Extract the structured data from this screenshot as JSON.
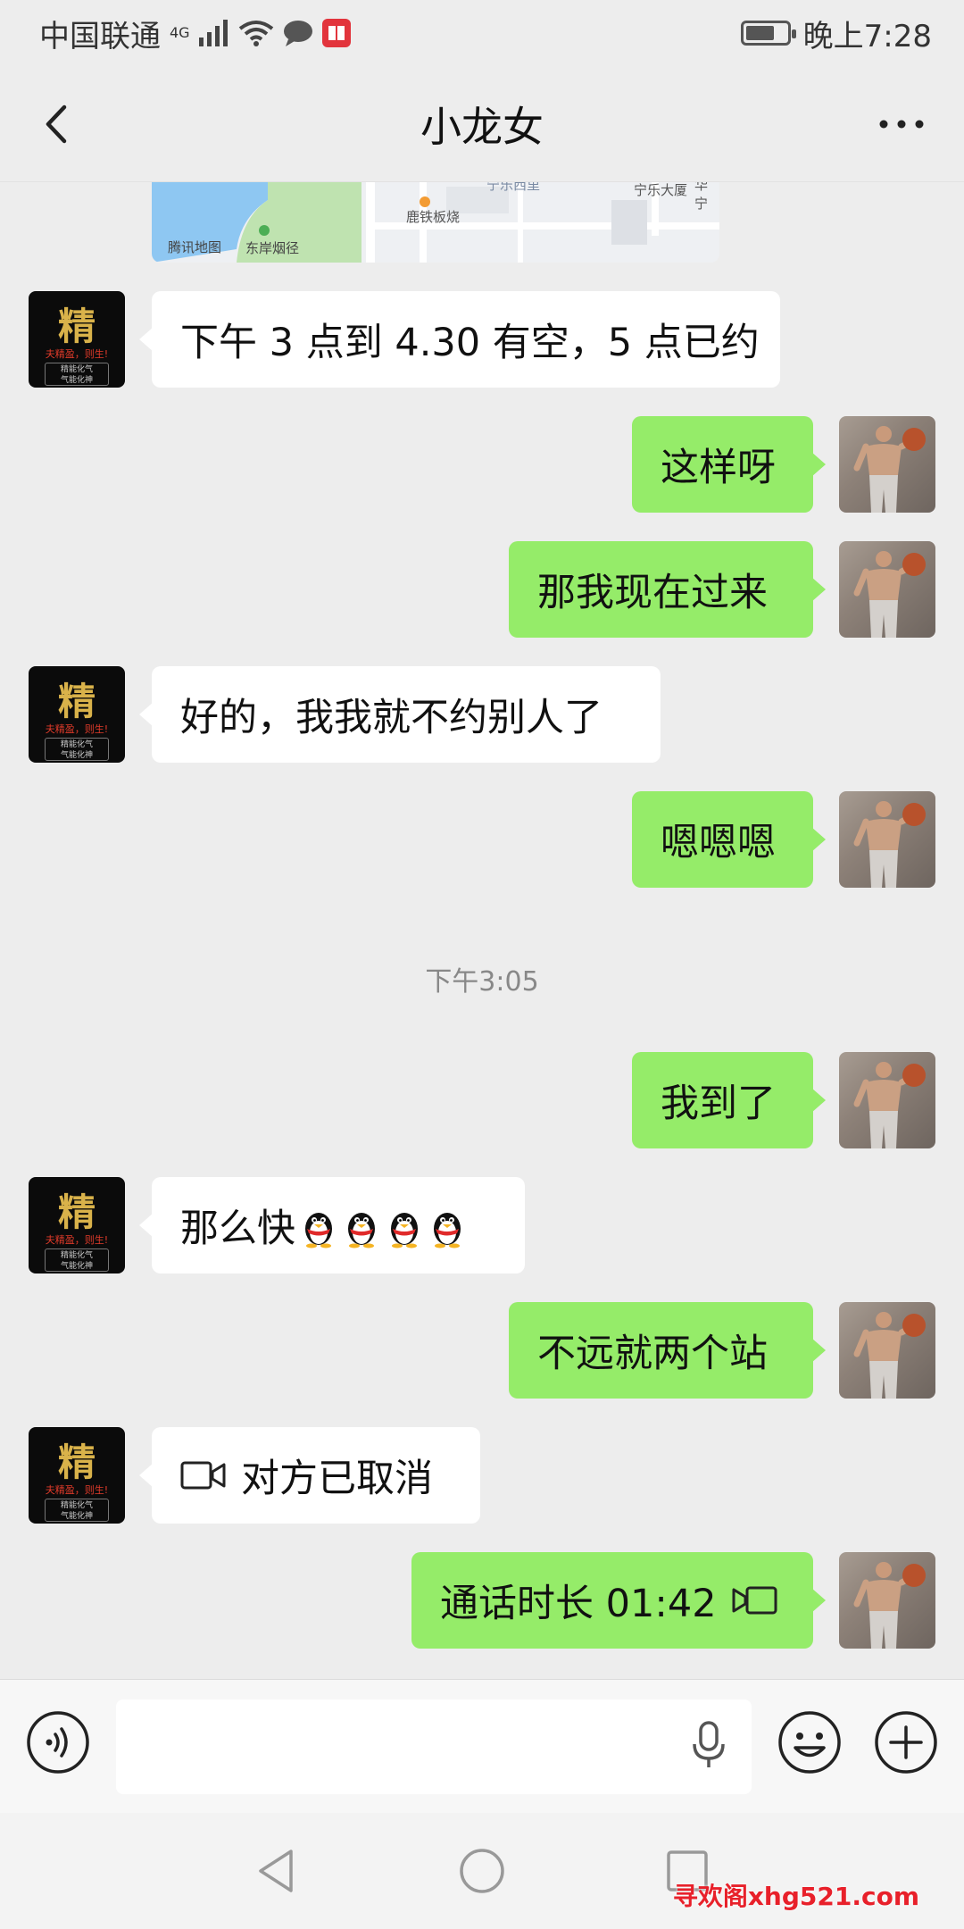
{
  "status_bar": {
    "carrier": "中国联通",
    "network": "4G",
    "time": "晚上7:28",
    "battery_level_fraction": 0.7
  },
  "header": {
    "title": "小龙女",
    "back_icon": "chevron-left-icon",
    "more_icon": "more-dots-icon"
  },
  "map_card": {
    "labels": [
      "宁乐西里",
      "宁乐大厦",
      "华宁",
      "鹿铁板烧",
      "腾讯地图",
      "东岸烟径"
    ]
  },
  "messages": [
    {
      "side": "left",
      "text": "下午 3 点到 4.30 有空，5 点已约"
    },
    {
      "side": "right",
      "text": "这样呀"
    },
    {
      "side": "right",
      "text": "那我现在过来"
    },
    {
      "side": "left",
      "text": "好的，我我就不约别人了"
    },
    {
      "side": "right",
      "text": "嗯嗯嗯"
    },
    {
      "type": "time",
      "text": "下午3:05"
    },
    {
      "side": "right",
      "text": "我到了"
    },
    {
      "side": "left",
      "text": "那么快",
      "emoji_count": 4,
      "emoji": "penguin"
    },
    {
      "side": "right",
      "text": "不远就两个站"
    },
    {
      "side": "left",
      "text": "对方已取消",
      "icon": "video-call-icon"
    },
    {
      "side": "right",
      "text": "通话时长 01:42",
      "icon": "video-call-icon"
    }
  ],
  "left_avatar": {
    "big_char": "精",
    "line1": "夫精盈，则生!",
    "line2": "精能化气",
    "line3": "气能化神"
  },
  "input_bar": {
    "voice_icon": "voice-mode-icon",
    "mic_icon": "microphone-icon",
    "emoji_icon": "emoji-icon",
    "plus_icon": "plus-icon"
  },
  "nav_bar": {
    "back_icon": "nav-back-icon",
    "home_icon": "nav-home-icon",
    "recents_icon": "nav-recents-icon"
  },
  "watermark": "寻欢阁xhg521.com",
  "colors": {
    "background": "#ededed",
    "sent_bubble": "#95ec69",
    "received_bubble": "#ffffff"
  }
}
